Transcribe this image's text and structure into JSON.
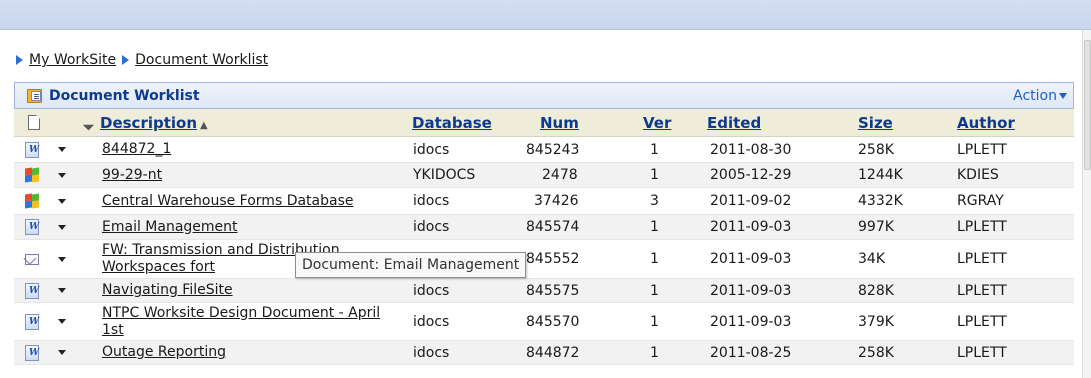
{
  "breadcrumb": {
    "worksite": "My WorkSite",
    "worklist": "Document Worklist"
  },
  "panel": {
    "title": "Document Worklist",
    "action_label": "Action",
    "icon": "worklist-folder-icon"
  },
  "columns": {
    "description": "Description",
    "database": "Database",
    "num": "Num",
    "ver": "Ver",
    "edited": "Edited",
    "size": "Size",
    "author": "Author",
    "sort_indicator": "▲"
  },
  "rows": [
    {
      "icon": "word-doc-icon",
      "description": "844872_1",
      "database": "idocs",
      "num": "845243",
      "ver": "1",
      "edited": "2011-08-30",
      "size": "258K",
      "author": "LPLETT"
    },
    {
      "icon": "windows-app-icon",
      "description": "99-29-nt",
      "database": "YKIDOCS",
      "num": "2478",
      "ver": "1",
      "edited": "2005-12-29",
      "size": "1244K",
      "author": "KDIES"
    },
    {
      "icon": "windows-app-icon",
      "description": "Central Warehouse Forms Database",
      "database": "idocs",
      "num": "37426",
      "ver": "3",
      "edited": "2011-09-02",
      "size": "4332K",
      "author": "RGRAY"
    },
    {
      "icon": "word-doc-icon",
      "description": "Email Management",
      "database": "idocs",
      "num": "845574",
      "ver": "1",
      "edited": "2011-09-03",
      "size": "997K",
      "author": "LPLETT"
    },
    {
      "icon": "email-icon",
      "description": "FW: Transmission and Distribution Workspaces fort",
      "database": "",
      "num": "845552",
      "ver": "1",
      "edited": "2011-09-03",
      "size": "34K",
      "author": "LPLETT"
    },
    {
      "icon": "word-doc-icon",
      "description": "Navigating FileSite",
      "database": "idocs",
      "num": "845575",
      "ver": "1",
      "edited": "2011-09-03",
      "size": "828K",
      "author": "LPLETT"
    },
    {
      "icon": "word-doc-icon",
      "description": "NTPC Worksite Design Document - April 1st",
      "database": "idocs",
      "num": "845570",
      "ver": "1",
      "edited": "2011-09-03",
      "size": "379K",
      "author": "LPLETT"
    },
    {
      "icon": "word-doc-icon",
      "description": "Outage Reporting",
      "database": "idocs",
      "num": "844872",
      "ver": "1",
      "edited": "2011-08-25",
      "size": "258K",
      "author": "LPLETT"
    }
  ],
  "tooltip": {
    "text": "Document:  Email Management"
  },
  "colors": {
    "header_text": "#0d3a8c",
    "link_blue": "#1f5fcc",
    "column_header_bg": "#efedd9",
    "top_bar": "#c8d6ee"
  }
}
